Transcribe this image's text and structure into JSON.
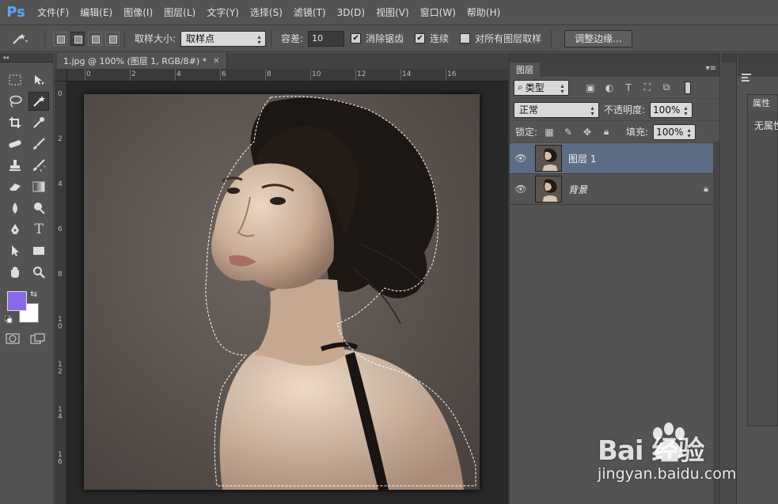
{
  "app": {
    "logo": "Ps"
  },
  "menu": [
    "文件(F)",
    "编辑(E)",
    "图像(I)",
    "图层(L)",
    "文字(Y)",
    "选择(S)",
    "滤镜(T)",
    "3D(D)",
    "视图(V)",
    "窗口(W)",
    "帮助(H)"
  ],
  "options": {
    "sample_size_label": "取样大小:",
    "sample_size_value": "取样点",
    "tolerance_label": "容差:",
    "tolerance_value": "10",
    "antialias_label": "消除锯齿",
    "antialias_checked": true,
    "contiguous_label": "连续",
    "contiguous_checked": true,
    "sample_all_label": "对所有图层取样",
    "sample_all_checked": false,
    "refine_edge_label": "调整边缘..."
  },
  "document": {
    "tab_title": "1.jpg @ 100% (图层 1, RGB/8#) *",
    "ruler_top_ticks": [
      "0",
      "2",
      "4",
      "6",
      "8",
      "10",
      "12",
      "14",
      "16"
    ],
    "ruler_left_ticks": [
      "0",
      "2",
      "4",
      "6",
      "8",
      "10",
      "12",
      "14",
      "16"
    ]
  },
  "tools": {
    "foreground_color": "#8a69e8",
    "background_color": "#ffffff"
  },
  "layers_panel": {
    "tab_label": "图层",
    "filter_kind": "类型",
    "blend_mode": "正常",
    "opacity_label": "不透明度:",
    "opacity_value": "100%",
    "lock_label": "锁定:",
    "fill_label": "填充:",
    "fill_value": "100%",
    "layers": [
      {
        "name": "图层 1",
        "selected": true,
        "locked": false
      },
      {
        "name": "背景",
        "selected": false,
        "locked": true
      }
    ]
  },
  "properties_panel": {
    "tab_label": "属性",
    "content_text": "无属性"
  },
  "watermark": {
    "brand": "Bai 经验",
    "url": "jingyan.baidu.com"
  }
}
